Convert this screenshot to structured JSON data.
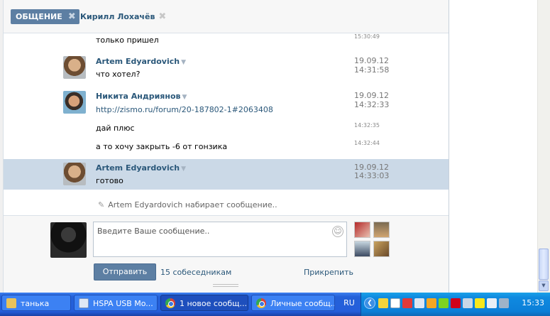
{
  "tabs": {
    "active_label": "ОБЩЕНИЕ",
    "user_label": "Кирилл Лохачёв"
  },
  "messages": {
    "top_text": "только пришел",
    "top_time": "15:30:49",
    "groups": [
      {
        "author": "Artem Edyardovich",
        "date": "19.09.12",
        "time": "14:31:58",
        "lines": [
          {
            "text": "что хотел?"
          }
        ]
      },
      {
        "author": "Никита Андриянов",
        "date": "19.09.12",
        "time": "14:32:33",
        "lines": [
          {
            "text": "http://zismo.ru/forum/20-187802-1#2063408"
          },
          {
            "text": "дай плюс",
            "time": "14:32:35"
          },
          {
            "text": "а то хочу закрыть -6 от гонзика",
            "time": "14:32:44"
          }
        ]
      },
      {
        "author": "Artem Edyardovich",
        "date": "19.09.12",
        "time": "14:33:03",
        "lines": [
          {
            "text": "готово"
          }
        ]
      }
    ]
  },
  "typing_indicator": "Artem Edyardovich набирает сообщение..",
  "compose": {
    "placeholder": "Введите Ваше сообщение..",
    "send_label": "Отправить",
    "participants_label": "15 собеседникам",
    "attach_label": "Прикрепить"
  },
  "taskbar": {
    "items": [
      {
        "label": "танька",
        "icon": "folder-icon"
      },
      {
        "label": "HSPA USB Mo...",
        "icon": "modem-icon"
      },
      {
        "label": "1 новое сообщ...",
        "icon": "chrome-icon"
      },
      {
        "label": "Личные сообщ...",
        "icon": "chrome-icon"
      }
    ],
    "language": "RU",
    "clock": "15:33"
  },
  "colors": {
    "accent": "#5d7fa3",
    "link": "#2b587a",
    "highlight_row": "#cbd9e7",
    "taskbar": "#245edb",
    "tray": "#0c7fd8"
  }
}
